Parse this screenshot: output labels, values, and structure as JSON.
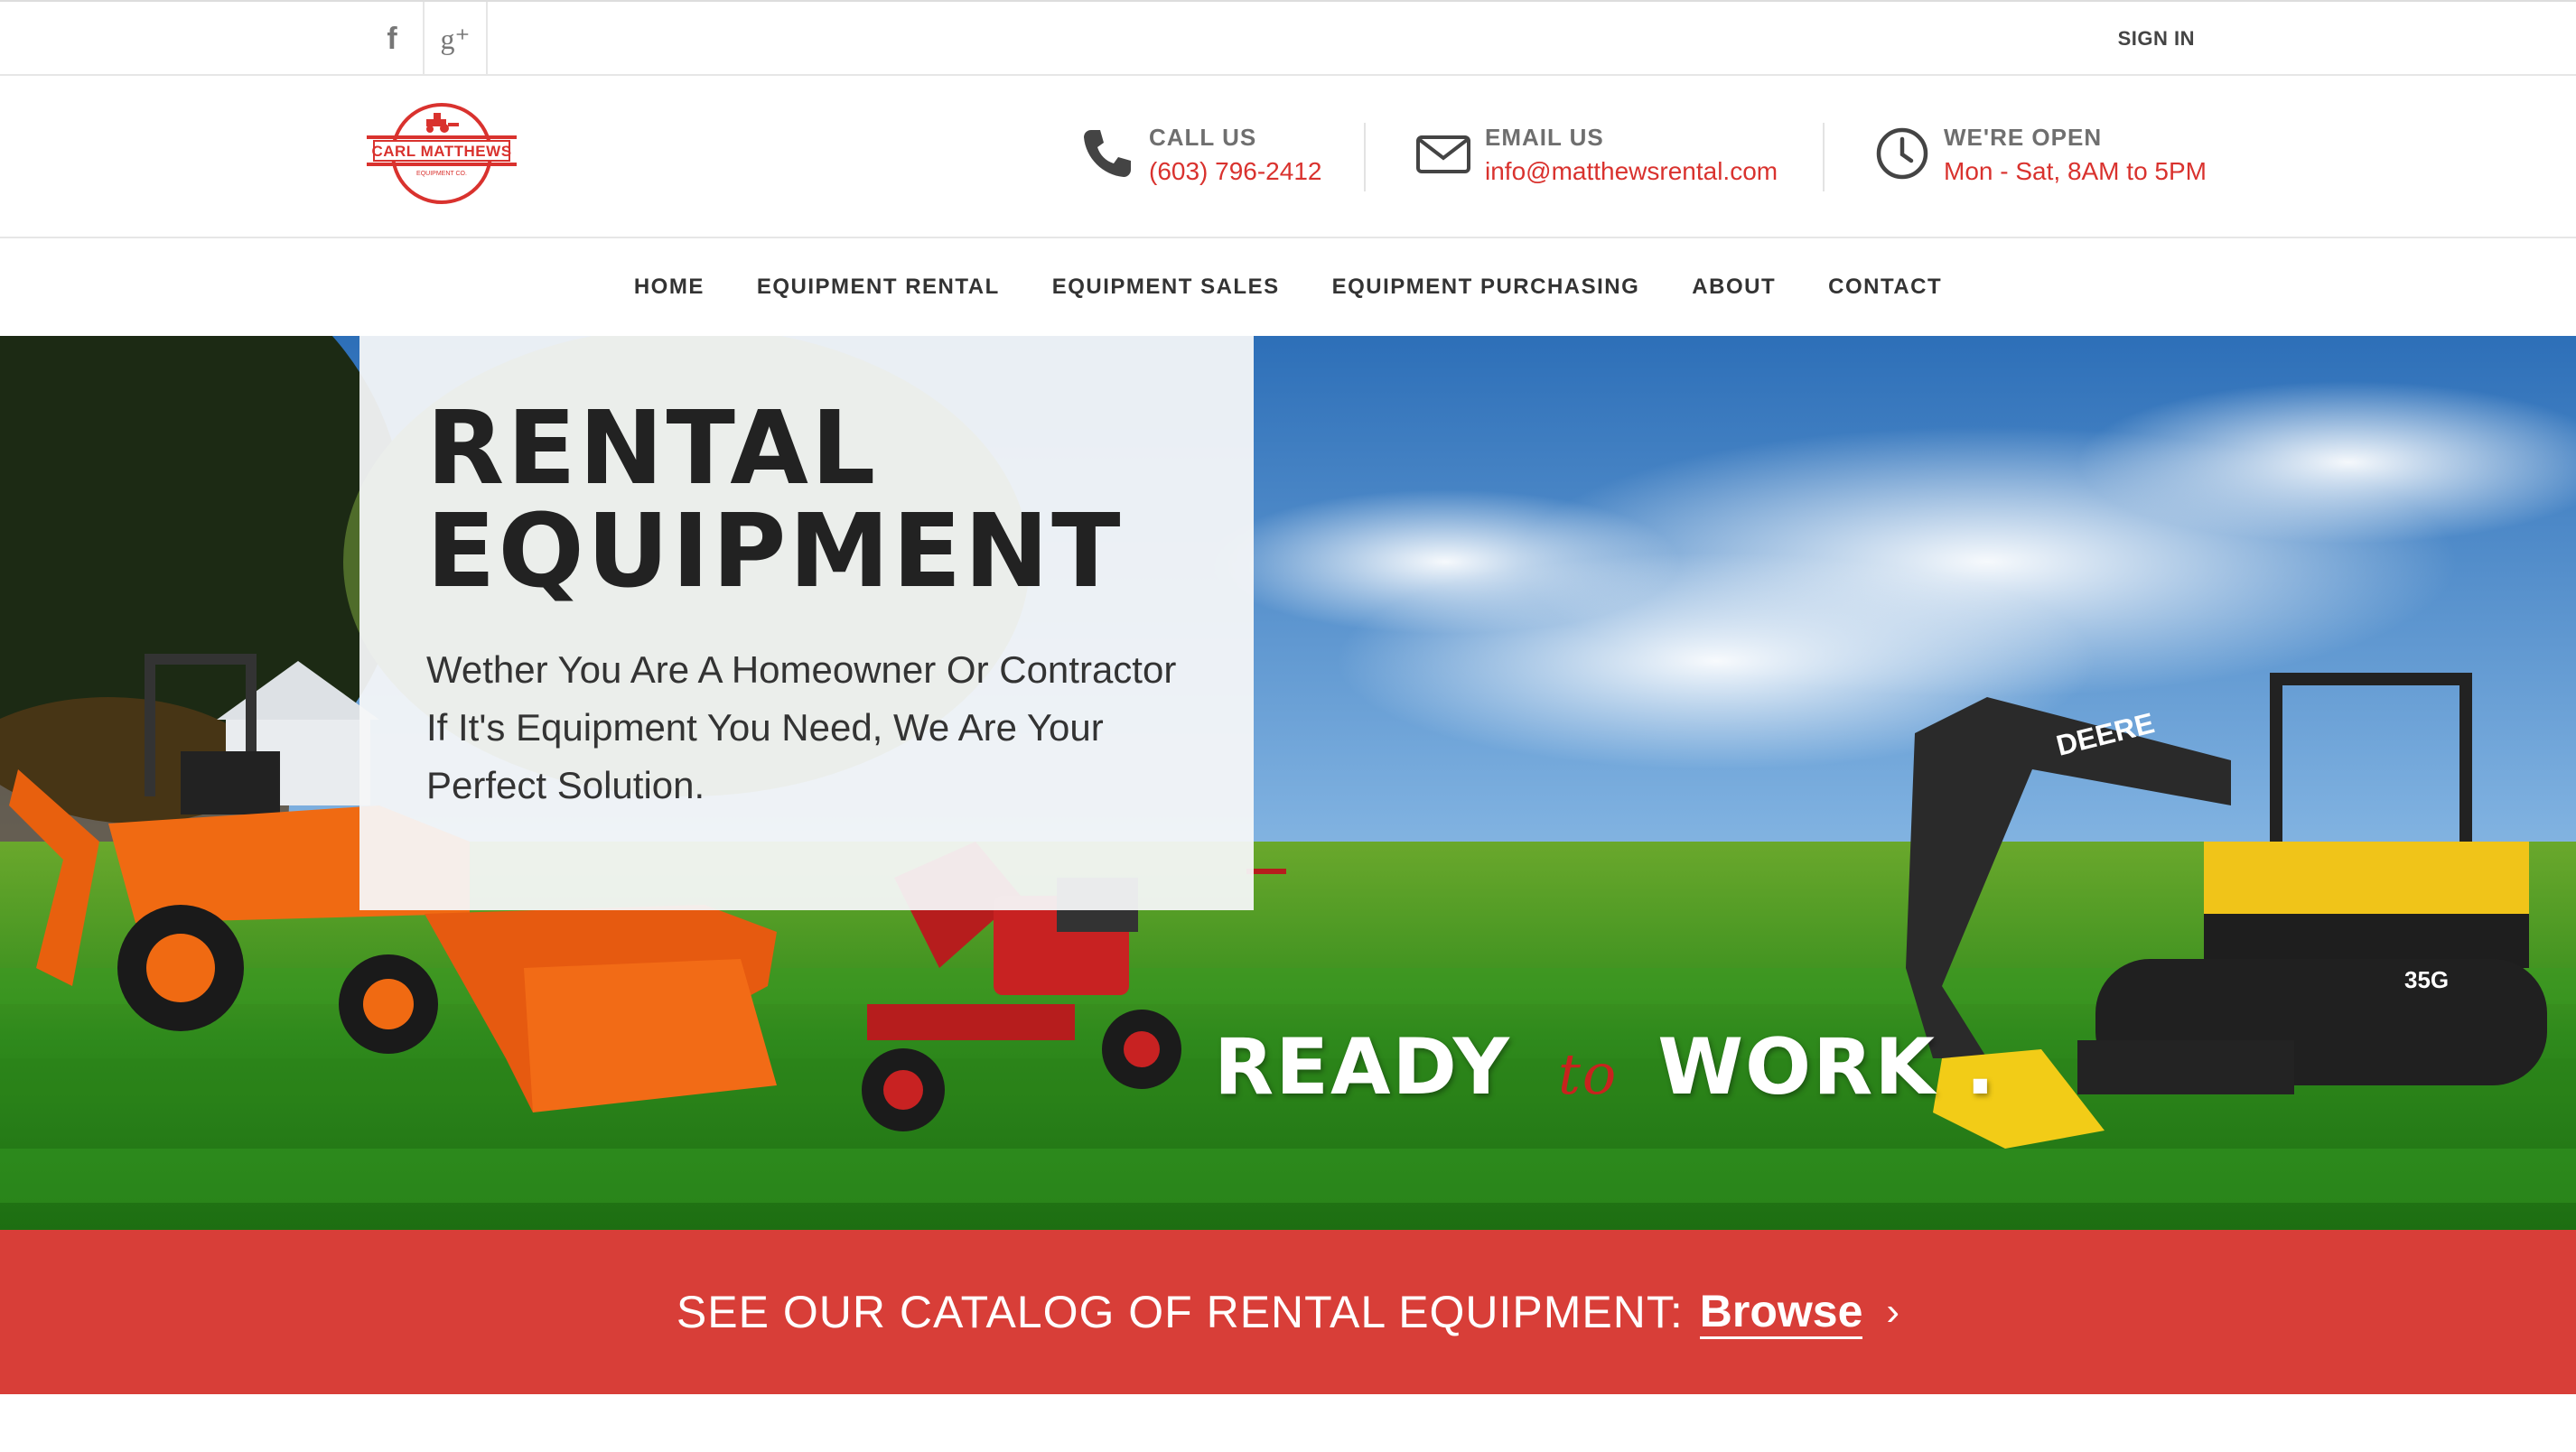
{
  "topbar": {
    "social": [
      {
        "icon": "facebook-icon",
        "glyph": "f"
      },
      {
        "icon": "google-plus-icon",
        "glyph": "g⁺"
      }
    ],
    "signin_label": "SIGN IN"
  },
  "header": {
    "logo": {
      "line1": "CARL MATTHEWS",
      "line2": "EQUIPMENT CO."
    },
    "contacts": [
      {
        "icon": "phone-icon",
        "label": "CALL US",
        "value": "(603) 796-2412"
      },
      {
        "icon": "envelope-icon",
        "label": "EMAIL US",
        "value": "info@matthewsrental.com"
      },
      {
        "icon": "clock-icon",
        "label": "WE'RE OPEN",
        "value": "Mon - Sat, 8AM to 5PM"
      }
    ]
  },
  "nav": {
    "items": [
      "HOME",
      "EQUIPMENT RENTAL",
      "EQUIPMENT SALES",
      "EQUIPMENT PURCHASING",
      "ABOUT",
      "CONTACT"
    ]
  },
  "hero": {
    "title_line1": "RENTAL",
    "title_line2": "EQUIPMENT",
    "subtitle": "Wether You Are A Homeowner Or Contractor If It's Equipment You Need, We Are Your Perfect Solution.",
    "tagline": {
      "word1": "READY",
      "connector": "to",
      "word2": "WORK ."
    },
    "excavator_brand": "DEERE",
    "excavator_model": "35G"
  },
  "cta": {
    "text": "SEE OUR CATALOG OF RENTAL EQUIPMENT:",
    "link_label": "Browse",
    "chevron": "›"
  },
  "colors": {
    "accent": "#d9322e",
    "cta_bg": "#d83e38",
    "text_dark": "#222222"
  }
}
